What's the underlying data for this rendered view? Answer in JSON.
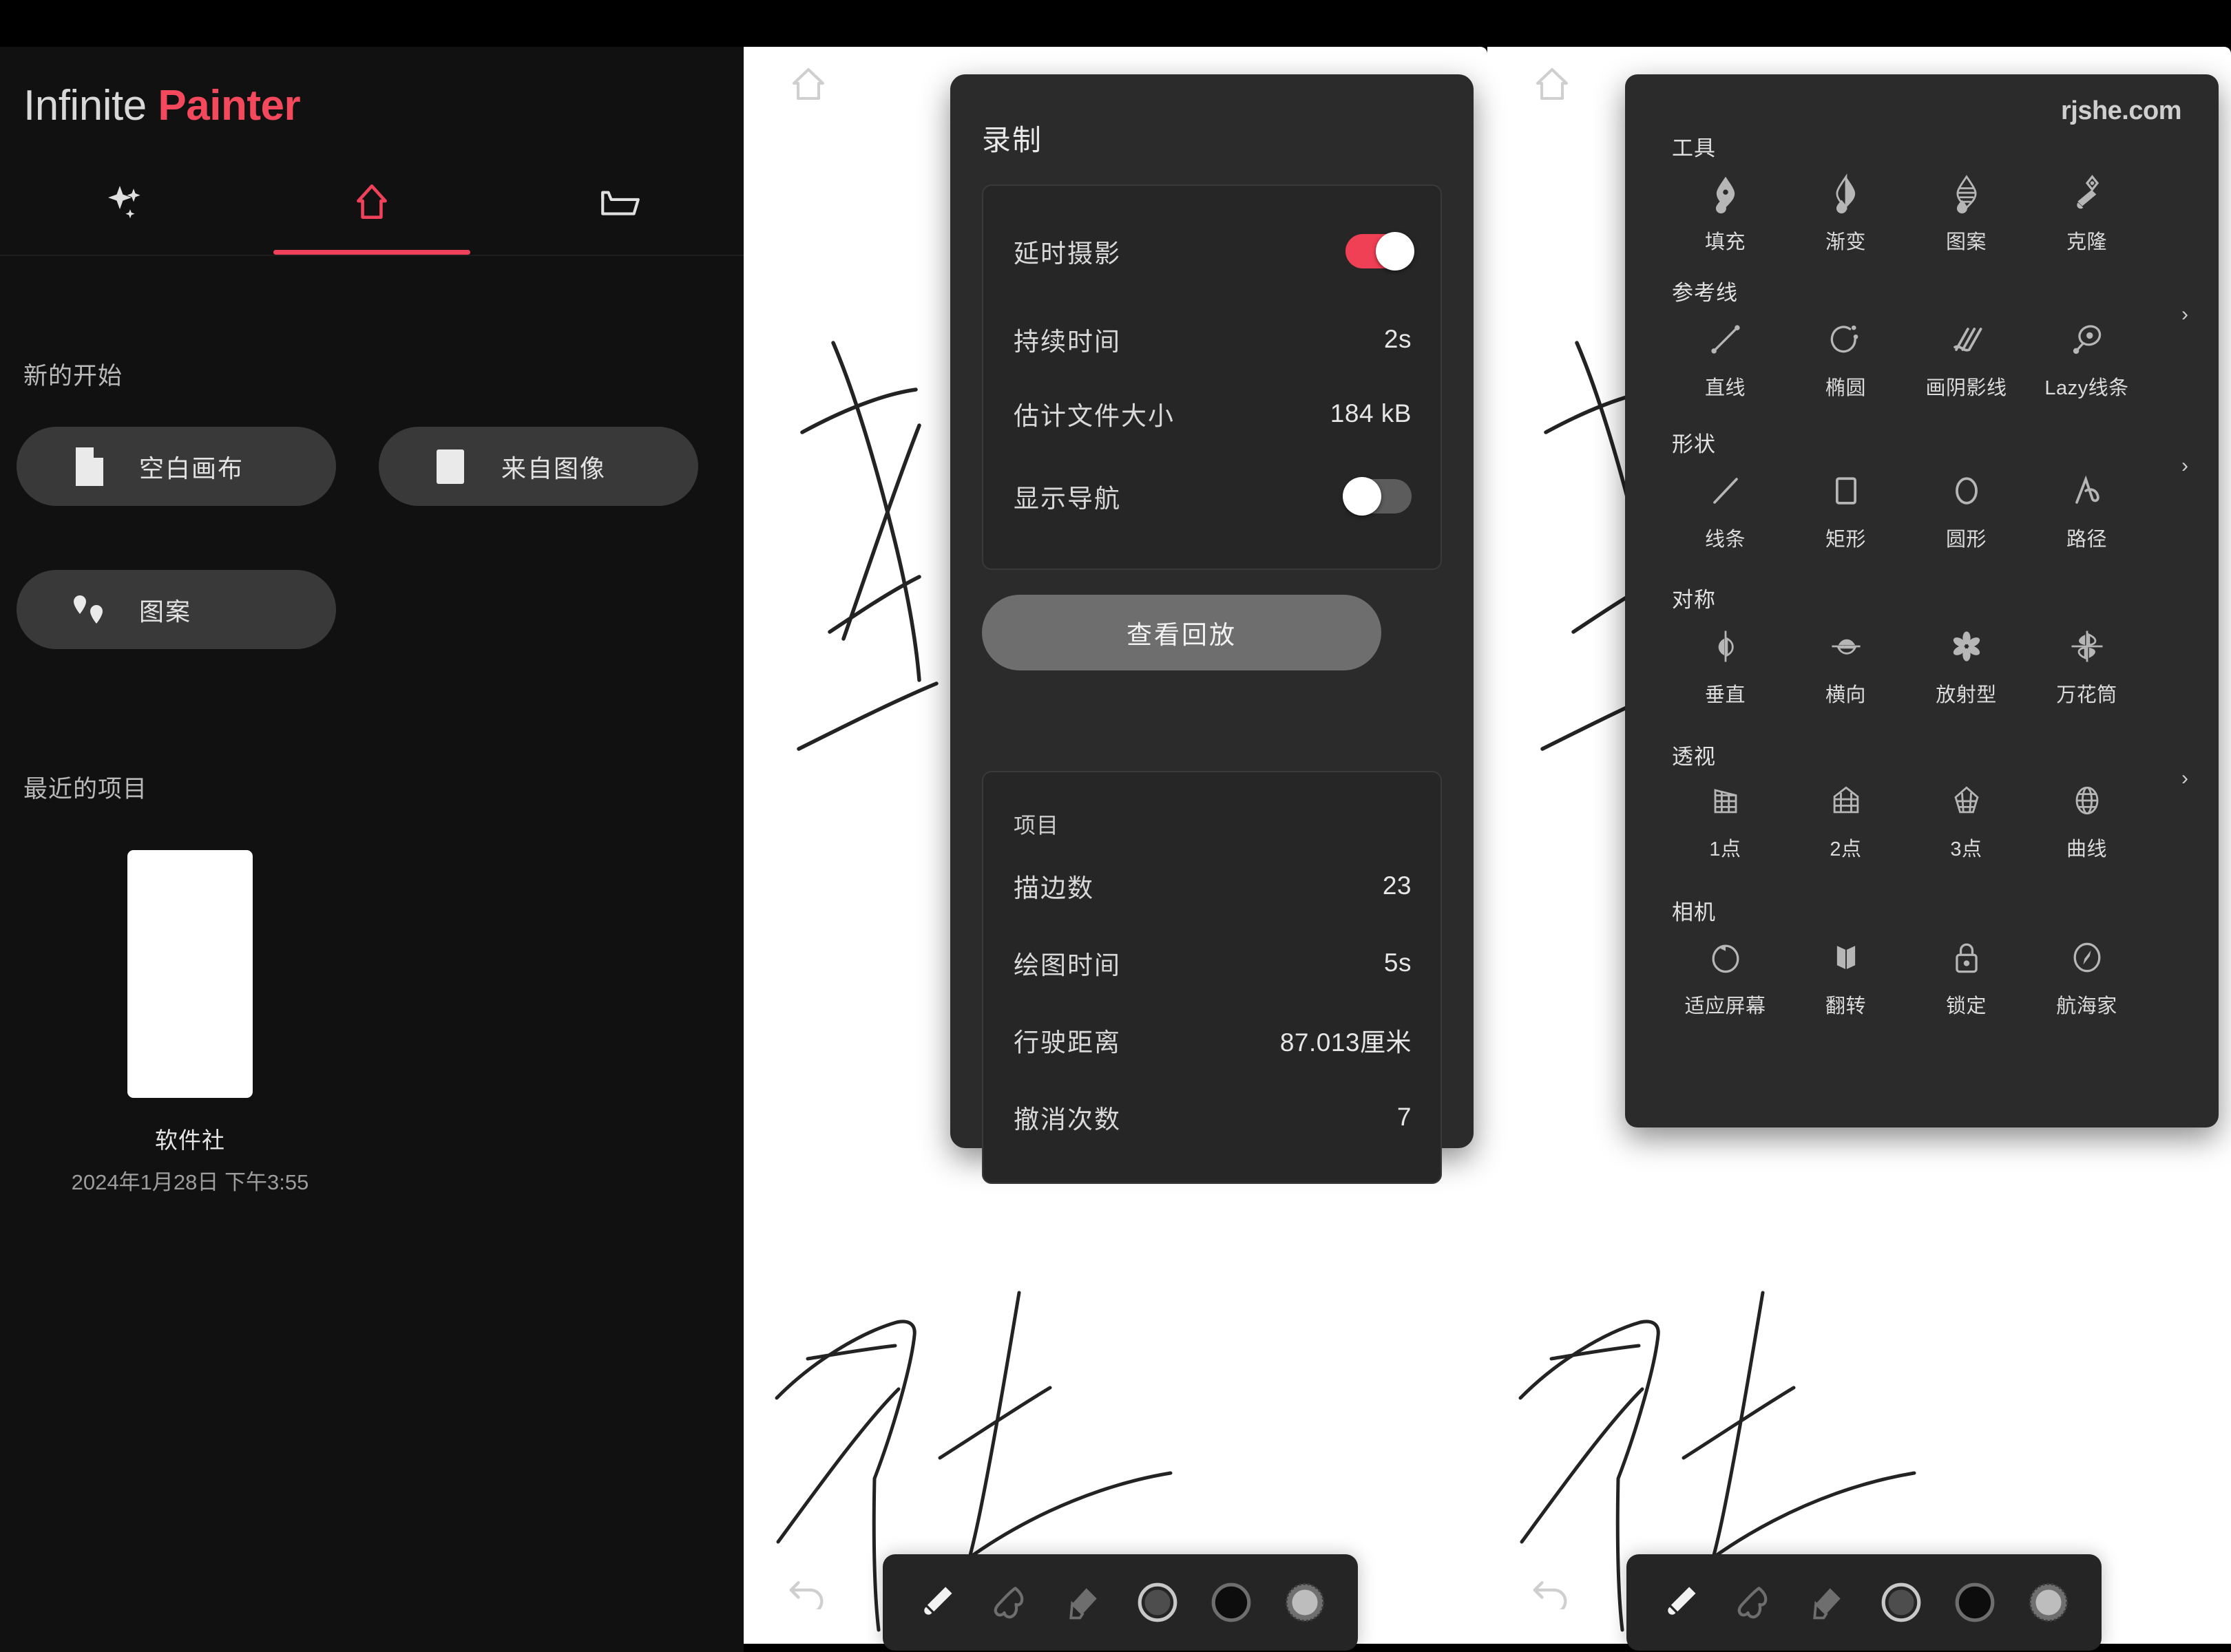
{
  "app": {
    "brand_light": "Infinite",
    "brand_bold": "Painter"
  },
  "home": {
    "tabs": [
      {
        "label": "discover",
        "icon": "sparkles-icon",
        "active": false
      },
      {
        "label": "home",
        "icon": "home-icon",
        "active": true
      },
      {
        "label": "files",
        "icon": "folder-icon",
        "active": false
      }
    ],
    "new_section_label": "新的开始",
    "start_buttons": [
      {
        "label": "空白画布",
        "icon": "blank-canvas-icon"
      },
      {
        "label": "来自图像",
        "icon": "from-image-icon"
      },
      {
        "label": "图案",
        "icon": "pattern-icon"
      }
    ],
    "recent_section_label": "最近的项目",
    "recent_projects": [
      {
        "name": "软件社",
        "date": "2024年1月28日 下午3:55"
      }
    ]
  },
  "record_dialog": {
    "title": "录制",
    "timelapse_label": "延时摄影",
    "timelapse_on": true,
    "duration_label": "持续时间",
    "duration_value": "2s",
    "filesize_label": "估计文件大小",
    "filesize_value": "184 kB",
    "show_nav_label": "显示导航",
    "show_nav_on": false,
    "playback_button": "查看回放",
    "project_section_label": "项目",
    "project_stats": [
      {
        "label": "描边数",
        "value": "23"
      },
      {
        "label": "绘图时间",
        "value": "5s"
      },
      {
        "label": "行驶距离",
        "value": "87.013厘米"
      },
      {
        "label": "撤消次数",
        "value": "7"
      }
    ]
  },
  "tools_panel": {
    "watermark": "rjshe.com",
    "sections": [
      {
        "heading": "工具",
        "has_chevron": false,
        "items": [
          {
            "label": "填充",
            "icon": "fill-nib-icon"
          },
          {
            "label": "渐变",
            "icon": "gradient-nib-icon"
          },
          {
            "label": "图案",
            "icon": "pattern-nib-icon"
          },
          {
            "label": "克隆",
            "icon": "clone-brush-icon"
          }
        ]
      },
      {
        "heading": "参考线",
        "has_chevron": true,
        "items": [
          {
            "label": "直线",
            "icon": "straight-line-icon"
          },
          {
            "label": "椭圆",
            "icon": "ellipse-guide-icon"
          },
          {
            "label": "画阴影线",
            "icon": "hatching-icon"
          },
          {
            "label": "Lazy线条",
            "icon": "lazy-line-icon"
          }
        ]
      },
      {
        "heading": "形状",
        "has_chevron": true,
        "items": [
          {
            "label": "线条",
            "icon": "line-shape-icon"
          },
          {
            "label": "矩形",
            "icon": "rectangle-icon"
          },
          {
            "label": "圆形",
            "icon": "circle-icon"
          },
          {
            "label": "路径",
            "icon": "path-icon"
          }
        ]
      },
      {
        "heading": "对称",
        "has_chevron": false,
        "items": [
          {
            "label": "垂直",
            "icon": "symmetry-vertical-icon"
          },
          {
            "label": "横向",
            "icon": "symmetry-horizontal-icon"
          },
          {
            "label": "放射型",
            "icon": "symmetry-radial-icon"
          },
          {
            "label": "万花筒",
            "icon": "kaleidoscope-icon"
          }
        ]
      },
      {
        "heading": "透视",
        "has_chevron": true,
        "items": [
          {
            "label": "1点",
            "icon": "perspective-1pt-icon"
          },
          {
            "label": "2点",
            "icon": "perspective-2pt-icon"
          },
          {
            "label": "3点",
            "icon": "perspective-3pt-icon"
          },
          {
            "label": "曲线",
            "icon": "perspective-curve-icon"
          }
        ]
      },
      {
        "heading": "相机",
        "has_chevron": false,
        "items": [
          {
            "label": "适应屏幕",
            "icon": "fit-screen-icon"
          },
          {
            "label": "翻转",
            "icon": "flip-icon"
          },
          {
            "label": "锁定",
            "icon": "lock-icon"
          },
          {
            "label": "航海家",
            "icon": "navigator-compass-icon"
          }
        ]
      }
    ]
  },
  "canvas": {
    "home_icon": "home-outline-icon",
    "undo_icon": "undo-arrow-icon",
    "dock_items": [
      {
        "icon": "brush-icon",
        "active": true
      },
      {
        "icon": "smudge-icon",
        "active": false
      },
      {
        "icon": "eraser-icon",
        "active": false
      },
      {
        "icon": "brush-size-icon",
        "active": false
      },
      {
        "icon": "color-swatch-icon",
        "active": false
      },
      {
        "icon": "opacity-checker-icon",
        "active": false
      }
    ]
  },
  "colors": {
    "accent": "#f0415a",
    "panel_bg": "#2b2b2b",
    "app_bg": "#111111",
    "toggle_on": "#f04055",
    "toggle_off": "#5c5c5c"
  }
}
